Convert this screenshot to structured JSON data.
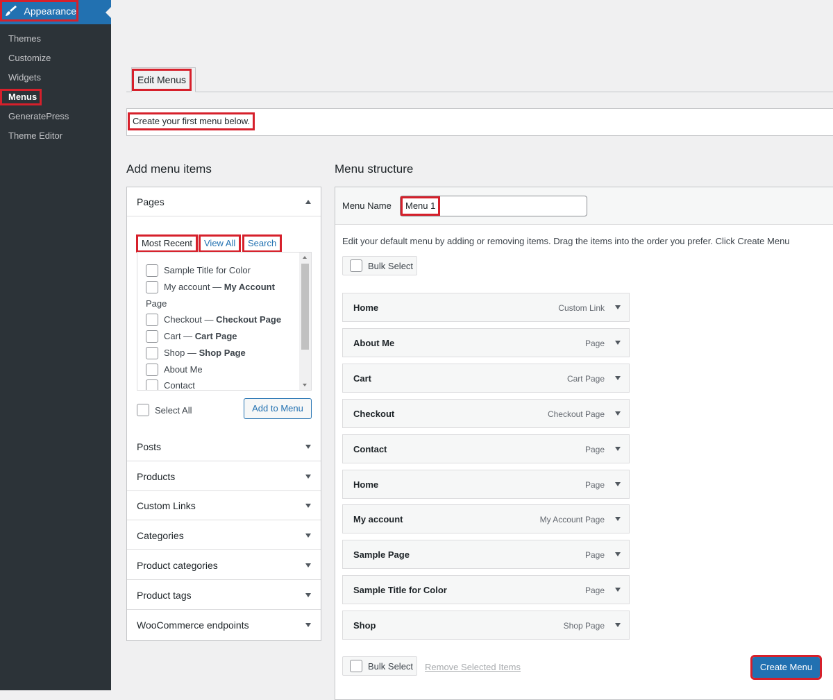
{
  "sidebar": {
    "current": "Appearance",
    "items": [
      "Themes",
      "Customize",
      "Widgets",
      "Menus",
      "GeneratePress",
      "Theme Editor"
    ]
  },
  "tabs": {
    "edit_menus": "Edit Menus"
  },
  "notice": "Create your first menu below.",
  "add_items": {
    "title": "Add menu items",
    "pages": {
      "heading": "Pages",
      "subtabs": [
        "Most Recent",
        "View All",
        "Search"
      ],
      "list": [
        {
          "label": "Sample Title for Color",
          "detail": ""
        },
        {
          "label": "My account",
          "detail": "My Account"
        },
        {
          "label": "Page",
          "detail": ""
        },
        {
          "label": "Checkout",
          "detail": "Checkout Page"
        },
        {
          "label": "Cart",
          "detail": "Cart Page"
        },
        {
          "label": "Shop",
          "detail": "Shop Page"
        },
        {
          "label": "About Me",
          "detail": ""
        },
        {
          "label": "Contact",
          "detail": ""
        }
      ],
      "separator": " — ",
      "select_all": "Select All",
      "add_button": "Add to Menu"
    },
    "sections": [
      "Posts",
      "Products",
      "Custom Links",
      "Categories",
      "Product categories",
      "Product tags",
      "WooCommerce endpoints"
    ]
  },
  "structure": {
    "title": "Menu structure",
    "name_label": "Menu Name",
    "name_value": "Menu 1",
    "instructions": "Edit your default menu by adding or removing items. Drag the items into the order you prefer. Click Create Menu",
    "bulk_select": "Bulk Select",
    "items": [
      {
        "title": "Home",
        "type": "Custom Link"
      },
      {
        "title": "About Me",
        "type": "Page"
      },
      {
        "title": "Cart",
        "type": "Cart Page"
      },
      {
        "title": "Checkout",
        "type": "Checkout Page"
      },
      {
        "title": "Contact",
        "type": "Page"
      },
      {
        "title": "Home",
        "type": "Page"
      },
      {
        "title": "My account",
        "type": "My Account Page"
      },
      {
        "title": "Sample Page",
        "type": "Page"
      },
      {
        "title": "Sample Title for Color",
        "type": "Page"
      },
      {
        "title": "Shop",
        "type": "Shop Page"
      }
    ],
    "remove_selected": "Remove Selected Items",
    "create_button": "Create Menu"
  }
}
